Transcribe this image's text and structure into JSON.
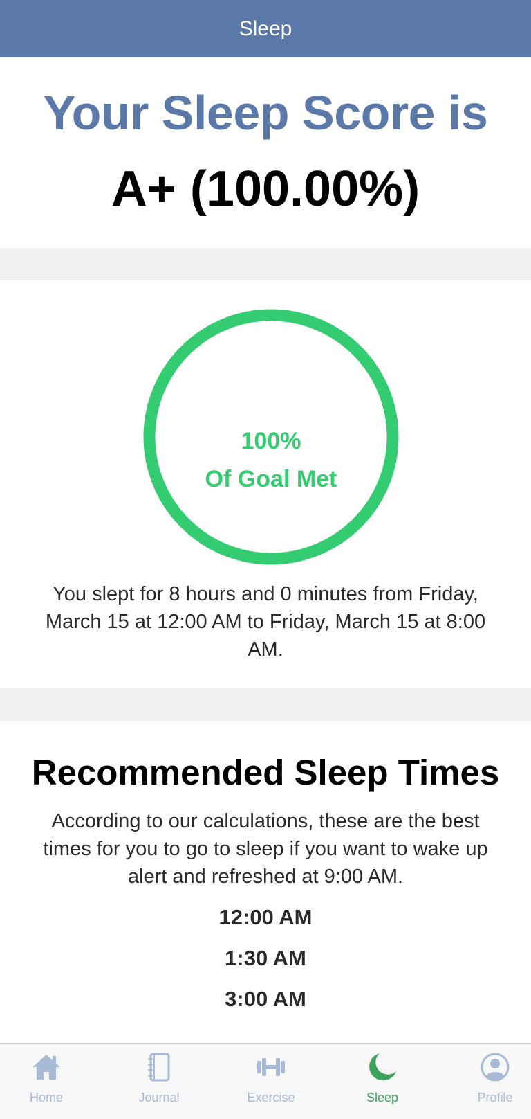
{
  "nav": {
    "title": "Sleep"
  },
  "score": {
    "heading": "Your Sleep Score is",
    "value": "A+ (100.00%)"
  },
  "goal": {
    "percent_text": "100%",
    "label": "Of Goal Met",
    "progress": 1.0,
    "summary": "You slept for 8 hours and 0 minutes from Friday, March 15 at 12:00 AM to Friday, March 15 at 8:00 AM."
  },
  "recommended": {
    "heading": "Recommended Sleep Times",
    "description": "According to our calculations, these are the best times for you to go to sleep if you want to wake up alert and refreshed at 9:00 AM.",
    "times": [
      "12:00 AM",
      "1:30 AM",
      "3:00 AM"
    ]
  },
  "tabs": [
    {
      "label": "Home",
      "icon": "home-icon",
      "active": false
    },
    {
      "label": "Journal",
      "icon": "journal-icon",
      "active": false
    },
    {
      "label": "Exercise",
      "icon": "dumbbell-icon",
      "active": false
    },
    {
      "label": "Sleep",
      "icon": "moon-icon",
      "active": true
    },
    {
      "label": "Profile",
      "icon": "profile-icon",
      "active": false
    }
  ],
  "colors": {
    "brand": "#5a78a8",
    "goal": "#33cc70",
    "tab_inactive": "#a7bad6",
    "tab_active": "#3ba45a"
  }
}
